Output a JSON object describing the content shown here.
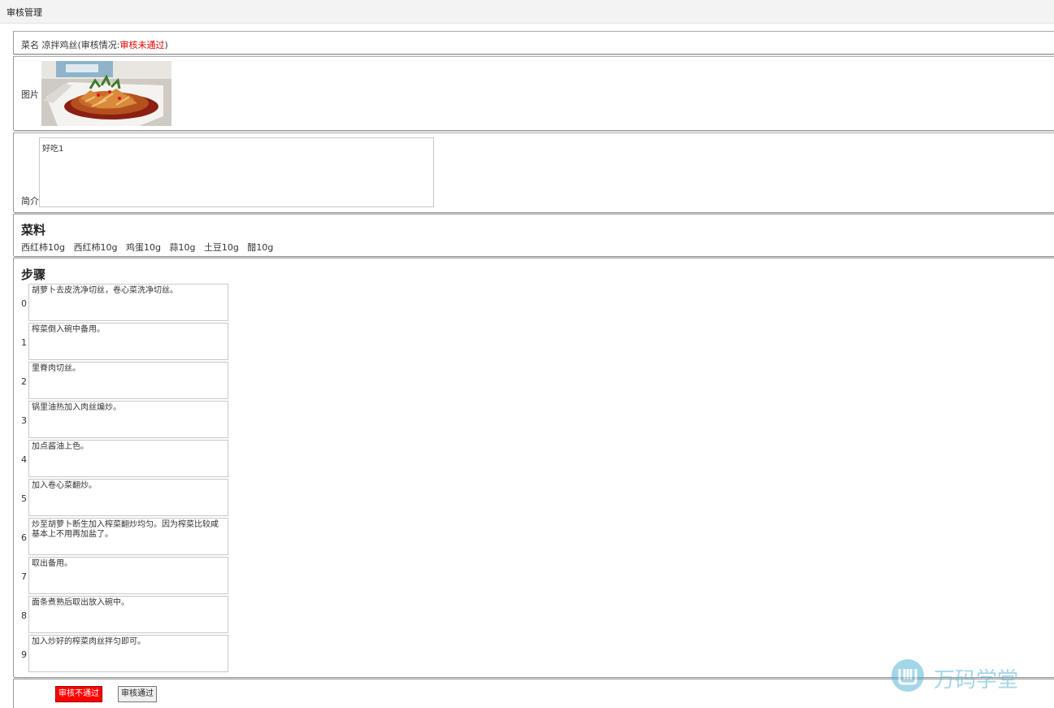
{
  "header": {
    "title": "审核管理"
  },
  "dish": {
    "name_label": "菜名",
    "name": "凉拌鸡丝",
    "status_prefix": "(审核情况:",
    "status": "审核未通过",
    "status_suffix": ")"
  },
  "image": {
    "label": "图片"
  },
  "intro": {
    "label": "简介",
    "text": "好吃1"
  },
  "ingredients": {
    "title": "菜料",
    "items": [
      "西红柿10g",
      "西红柿10g",
      "鸡蛋10g",
      "蒜10g",
      "土豆10g",
      "醋10g"
    ]
  },
  "steps": {
    "title": "步骤",
    "items": [
      {
        "num": "0",
        "text": "胡萝卜去皮洗净切丝，卷心菜洗净切丝。"
      },
      {
        "num": "1",
        "text": "榨菜倒入碗中备用。"
      },
      {
        "num": "2",
        "text": "里脊肉切丝。"
      },
      {
        "num": "3",
        "text": "锅里油热加入肉丝煸炒。"
      },
      {
        "num": "4",
        "text": "加点酱油上色。"
      },
      {
        "num": "5",
        "text": "加入卷心菜翻炒。"
      },
      {
        "num": "6",
        "text": "炒至胡萝卜断生加入榨菜翻炒均匀。因为榨菜比较咸基本上不用再加盐了。"
      },
      {
        "num": "7",
        "text": "取出备用。"
      },
      {
        "num": "8",
        "text": "面条煮熟后取出放入碗中。"
      },
      {
        "num": "9",
        "text": "加入炒好的榨菜肉丝拌匀即可。"
      }
    ]
  },
  "actions": {
    "reject_label": "审核不通过",
    "approve_label": "审核通过"
  },
  "watermark": {
    "text": "万码学堂"
  },
  "colors": {
    "status_fail": "#e00000",
    "reject_button": "#ff0000",
    "watermark": "#5ab6d8"
  }
}
